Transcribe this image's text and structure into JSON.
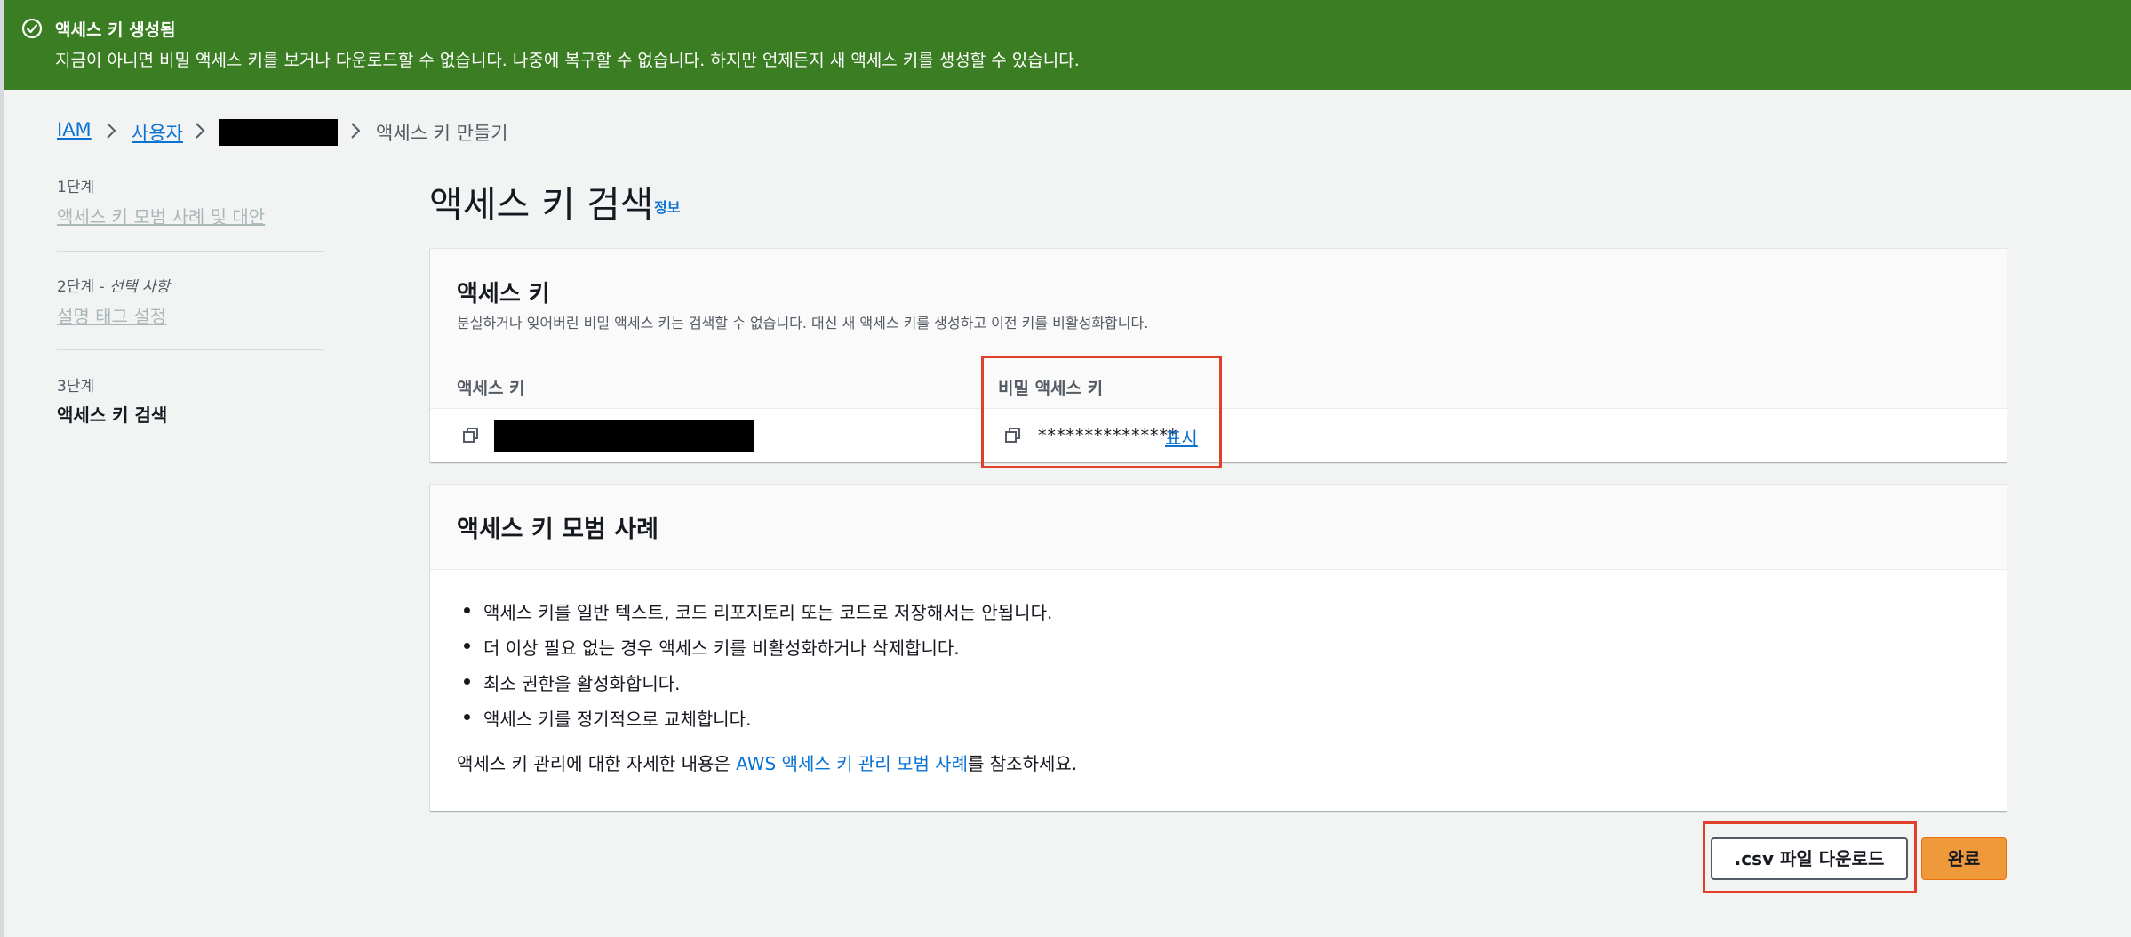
{
  "flash": {
    "title": "액세스 키 생성됨",
    "message": "지금이 아니면 비밀 액세스 키를 보거나 다운로드할 수 없습니다. 나중에 복구할 수 없습니다. 하지만 언제든지 새 액세스 키를 생성할 수 있습니다.",
    "color": "#3b7d23",
    "icon": "check-circle-icon"
  },
  "breadcrumb": {
    "items": [
      {
        "label": "IAM"
      },
      {
        "label": "사용자"
      }
    ],
    "current": "액세스 키 만들기"
  },
  "steps": [
    {
      "number": "1단계",
      "label": "액세스 키 모범 사례 및 대안"
    },
    {
      "number": "2단계",
      "optional": "선택 사항",
      "label": "설명 태그 설정"
    },
    {
      "number": "3단계",
      "label": "액세스 키 검색"
    }
  ],
  "page": {
    "title": "액세스 키 검색",
    "info_link": "정보"
  },
  "access_key_panel": {
    "title": "액세스 키",
    "description": "분실하거나 잊어버린 비밀 액세스 키는 검색할 수 없습니다. 대신 새 액세스 키를 생성하고 이전 키를 비활성화합니다.",
    "columns": [
      "액세스 키",
      "비밀 액세스 키"
    ],
    "secret_masked": "***************",
    "show_label": "표시"
  },
  "best_practices_panel": {
    "title": "액세스 키 모범 사례",
    "bullets": [
      "액세스 키를 일반 텍스트, 코드 리포지토리 또는 코드로 저장해서는 안됩니다.",
      "더 이상 필요 없는 경우 액세스 키를 비활성화하거나 삭제합니다.",
      "최소 권한을 활성화합니다.",
      "액세스 키를 정기적으로 교체합니다."
    ],
    "footer_prefix": "액세스 키 관리에 대한 자세한 내용은 ",
    "footer_link": "AWS 액세스 키 관리 모범 사례",
    "footer_suffix": "를 참조하세요."
  },
  "actions": {
    "download_label": ".csv 파일 다운로드",
    "done_label": "완료"
  },
  "colors": {
    "link": "#0972d3",
    "highlight": "#e0402a",
    "primary_button": "#f0993b"
  }
}
